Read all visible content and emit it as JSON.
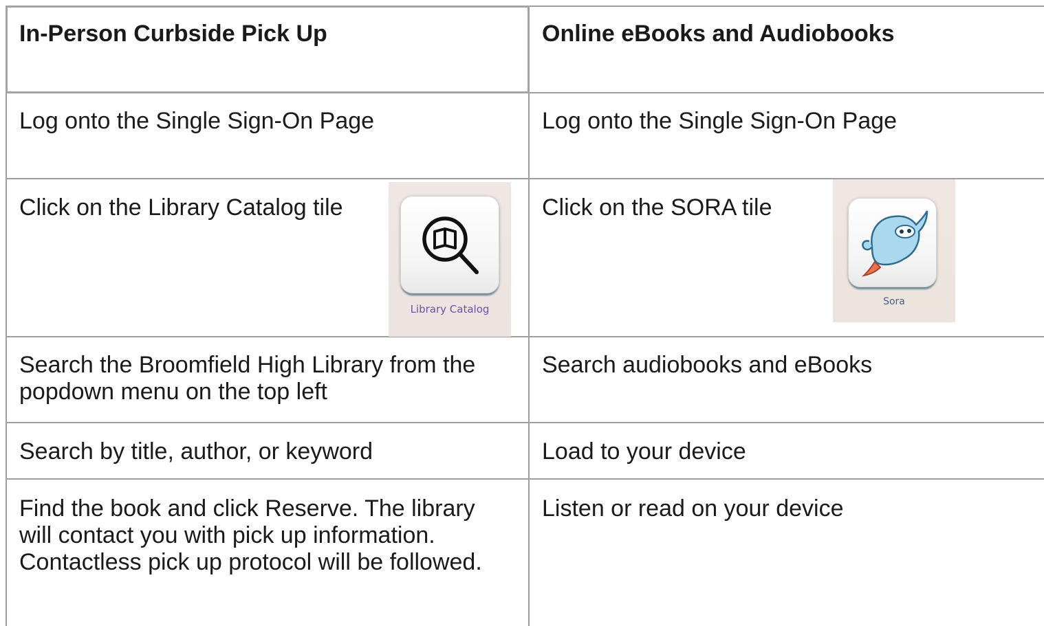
{
  "table": {
    "headers": [
      "In-Person Curbside Pick Up",
      "Online eBooks and Audiobooks"
    ],
    "rows": [
      [
        "Log onto the Single Sign-On Page",
        "Log onto the Single Sign-On Page"
      ],
      [
        "Click on the Library Catalog tile",
        "Click on the SORA tile"
      ],
      [
        "Search the Broomfield High Library from the popdown menu on the top left",
        "Search audiobooks and eBooks"
      ],
      [
        "Search by title, author, or keyword",
        "Load to your device"
      ],
      [
        "Find the book and click Reserve. The library will contact you with pick up information. Contactless pick up protocol will be followed.",
        "Listen or read on your device"
      ]
    ]
  },
  "tiles": {
    "catalog": {
      "label": "Library Catalog",
      "icon": "book-magnifier-icon"
    },
    "sora": {
      "label": "Sora",
      "icon": "sora-mascot-icon"
    }
  },
  "colors": {
    "grid_line": "#9e9e9e",
    "tile_label": "#6a53a6",
    "tile_background": "#efe5e1"
  }
}
